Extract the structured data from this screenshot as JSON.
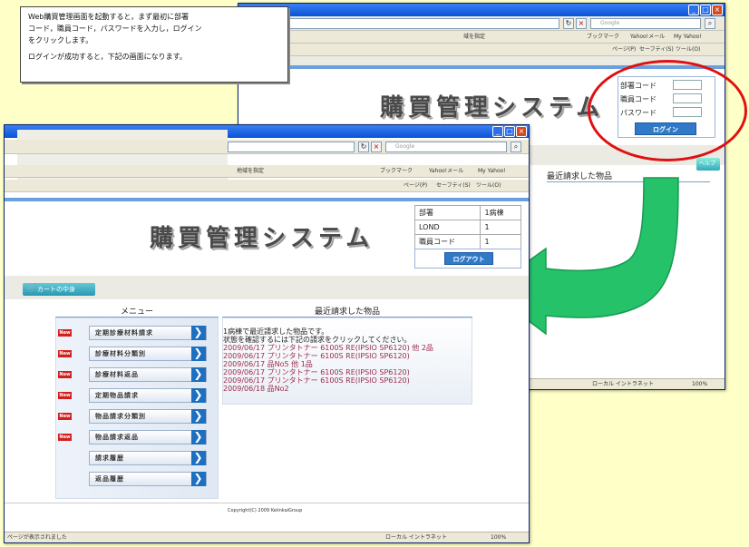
{
  "callout": {
    "line1": "Web購買管理画面を起動すると，まず最初に部署",
    "line2": "コード，職員コード，パスワードを入力し，ログイン",
    "line3": "をクリックします。",
    "line4": "ログインが成功すると，下記の画面になります。"
  },
  "system_title": "購買管理システム",
  "browser": {
    "search_placeholder": "Google",
    "links_text": "地域を指定",
    "bookmarks": "ブックマーク",
    "yahoo_mail": "Yahoo!メール",
    "my_yahoo": "My Yahoo!",
    "page_menu": "ページ(P)",
    "safety_menu": "セーフティ(S)",
    "tools_menu": "ツール(O)",
    "zone": "ローカル イントラネット",
    "zoom": "100%",
    "status_text": "ページが表示されました"
  },
  "login": {
    "dept_label": "部署コード",
    "staff_label": "職員コード",
    "password_label": "パスワード",
    "button": "ログイン",
    "help": "ヘルプ"
  },
  "user_info": {
    "rows": [
      {
        "label": "部署",
        "value": "1病棟"
      },
      {
        "label": "LOND",
        "value": "1"
      },
      {
        "label": "職員コード",
        "value": "1"
      }
    ],
    "logout_button": "ログアウト"
  },
  "cart_button": "カートの中身",
  "menu": {
    "heading": "メニュー",
    "items": [
      {
        "label": "定期診療材料請求",
        "new": true
      },
      {
        "label": "診療材料分類別",
        "new": true
      },
      {
        "label": "診療材料返品",
        "new": true
      },
      {
        "label": "定期物品請求",
        "new": true
      },
      {
        "label": "物品請求分類別",
        "new": true
      },
      {
        "label": "物品請求返品",
        "new": true
      },
      {
        "label": "請求履歴",
        "new": false
      },
      {
        "label": "返品履歴",
        "new": false
      }
    ],
    "new_badge": "New"
  },
  "recent": {
    "heading": "最近請求した物品",
    "intro1": "1病棟で最近請求した物品です。",
    "intro2": "状態を確認するには下記の請求をクリックしてください。",
    "items": [
      "2009/06/17 プリンタトナー 6100S RE(IPSIO SP6120) 他 2品",
      "2009/06/17 プリンタトナー 6100S RE(IPSIO SP6120)",
      "2009/06/17 品No5 他 1品",
      "2009/06/17 プリンタトナー 6100S RE(IPSIO SP6120)",
      "2009/06/17 プリンタトナー 6100S RE(IPSIO SP6120)",
      "2009/06/18 品No2"
    ]
  },
  "footer": "Copyright(C) 2009 KeiinkaiGroup",
  "back_window": {
    "recent_heading": "最近請求した物品",
    "toolbar_text": "域を指定"
  }
}
